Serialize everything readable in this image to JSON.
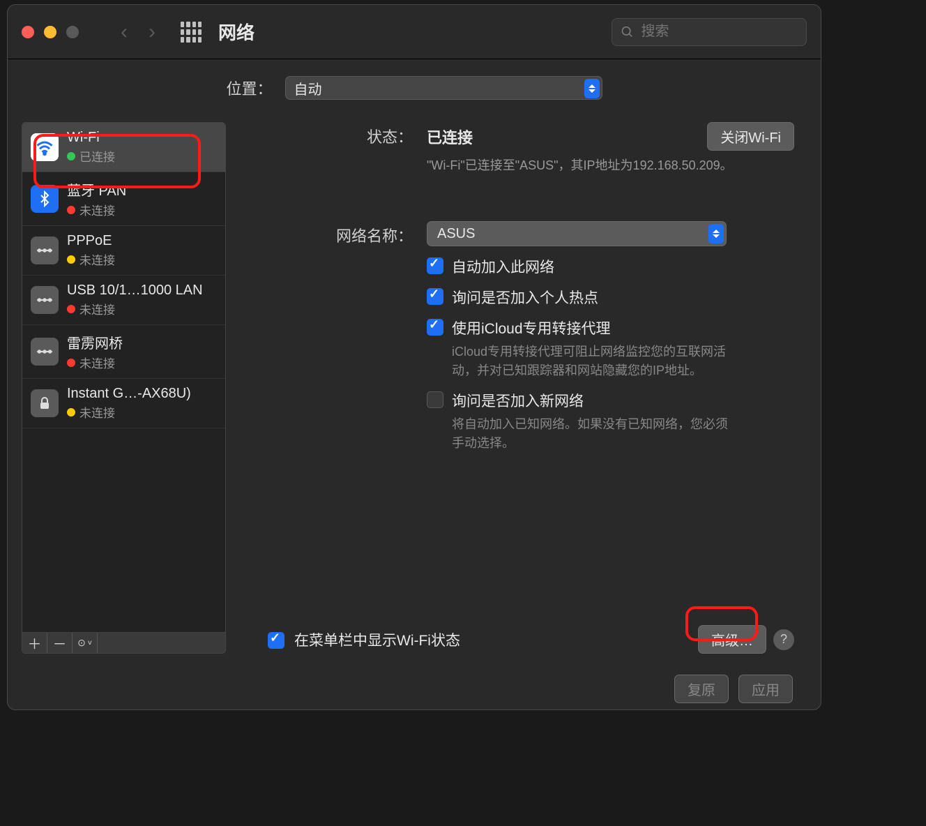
{
  "window": {
    "title": "网络"
  },
  "search": {
    "placeholder": "搜索"
  },
  "location": {
    "label": "位置：",
    "value": "自动"
  },
  "services": [
    {
      "name": "Wi-Fi",
      "status": "已连接",
      "dot": "green",
      "icon": "wifi",
      "selected": true
    },
    {
      "name": "蓝牙 PAN",
      "status": "未连接",
      "dot": "red",
      "icon": "bt"
    },
    {
      "name": "PPPoE",
      "status": "未连接",
      "dot": "yellow",
      "icon": "eth"
    },
    {
      "name": "USB 10/1…1000 LAN",
      "status": "未连接",
      "dot": "red",
      "icon": "eth"
    },
    {
      "name": "雷雳网桥",
      "status": "未连接",
      "dot": "red",
      "icon": "eth"
    },
    {
      "name": "Instant G…-AX68U)",
      "status": "未连接",
      "dot": "yellow",
      "icon": "lock"
    }
  ],
  "detail": {
    "status_label": "状态：",
    "status_value": "已连接",
    "toggle_button": "关闭Wi-Fi",
    "status_desc": "\"Wi-Fi\"已连接至\"ASUS\"，其IP地址为192.168.50.209。",
    "network_label": "网络名称：",
    "network_value": "ASUS",
    "cb_auto_join": "自动加入此网络",
    "cb_ask_hotspot": "询问是否加入个人热点",
    "cb_icloud_relay": "使用iCloud专用转接代理",
    "icloud_desc": "iCloud专用转接代理可阻止网络监控您的互联网活动，并对已知跟踪器和网站隐藏您的IP地址。",
    "cb_ask_new": "询问是否加入新网络",
    "ask_new_desc": "将自动加入已知网络。如果没有已知网络，您必须手动选择。",
    "cb_menubar": "在菜单栏中显示Wi-Fi状态",
    "advanced_button": "高级…"
  },
  "footer": {
    "revert": "复原",
    "apply": "应用"
  }
}
